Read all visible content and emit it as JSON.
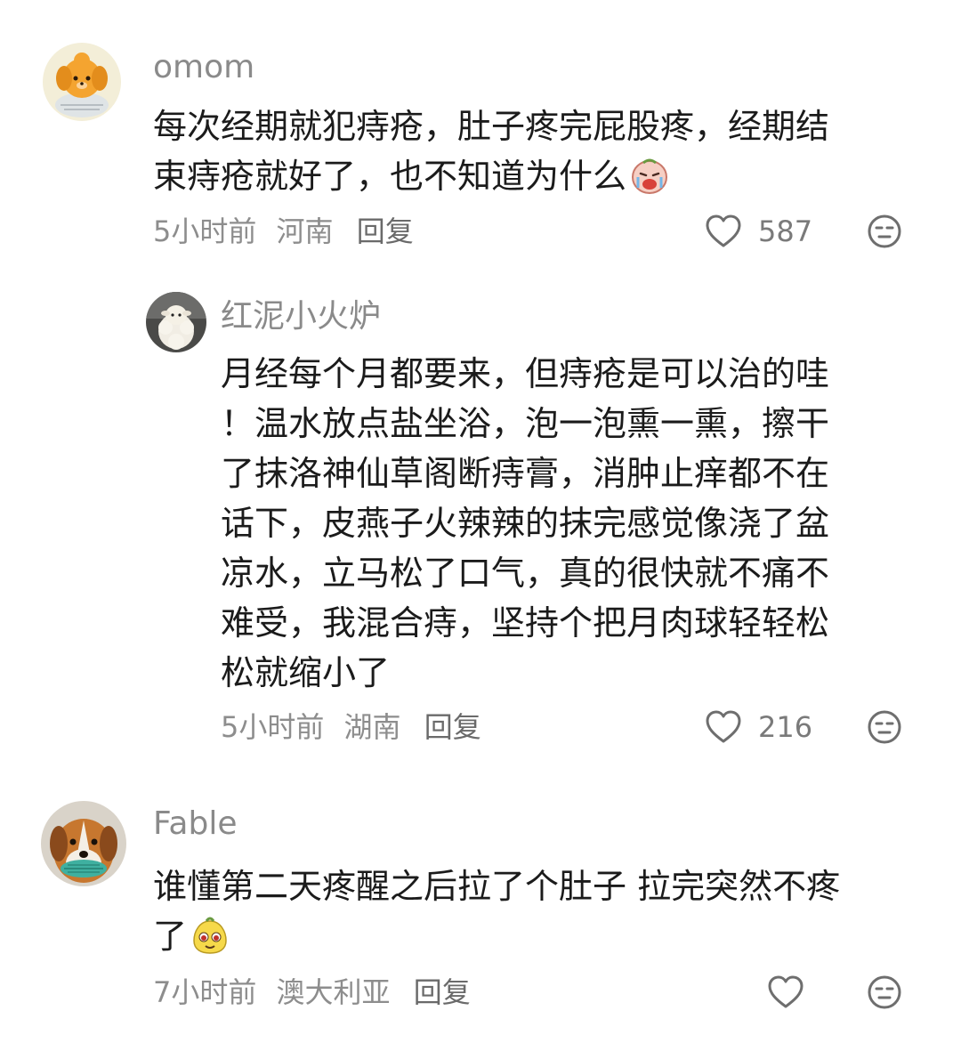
{
  "comments": [
    {
      "username": "omom",
      "avatar_icon": "cartoon-dog-avatar",
      "text_lines": [
        "每次经期就犯痔疮，肚子疼完屁股疼，经期结",
        "束痔疮就好了，也不知道为什么"
      ],
      "emoji_icon": "crying-face-emoji",
      "time": "5小时前",
      "location": "河南",
      "reply_label": "回复",
      "like_count": "587"
    },
    {
      "username": "红泥小火炉",
      "avatar_icon": "sheep-plush-avatar",
      "text_lines": [
        "月经每个月都要来，但痔疮是可以治的哇",
        "！温水放点盐坐浴，泡一泡熏一熏，擦干",
        "了抹洛神仙草阁断痔膏，消肿止痒都不在",
        "话下，皮燕子火辣辣的抹完感觉像浇了盆",
        "凉水，立马松了口气，真的很快就不痛不",
        "难受，我混合痔，坚持个把月肉球轻轻松",
        "松就缩小了"
      ],
      "time": "5小时前",
      "location": "湖南",
      "reply_label": "回复",
      "like_count": "216"
    },
    {
      "username": "Fable",
      "avatar_icon": "dog-with-toy-avatar",
      "text_lines": [
        "谁懂第二天疼醒之后拉了个肚子 拉完突然不疼",
        "了"
      ],
      "emoji_icon": "yellow-blob-emoji",
      "time": "7小时前",
      "location": "澳大利亚",
      "reply_label": "回复",
      "like_count": ""
    }
  ],
  "colors": {
    "text": "#1b1b1b",
    "meta": "#8d8d8d",
    "username": "#8a8a8a",
    "icon_stroke": "#6e6e6e"
  }
}
